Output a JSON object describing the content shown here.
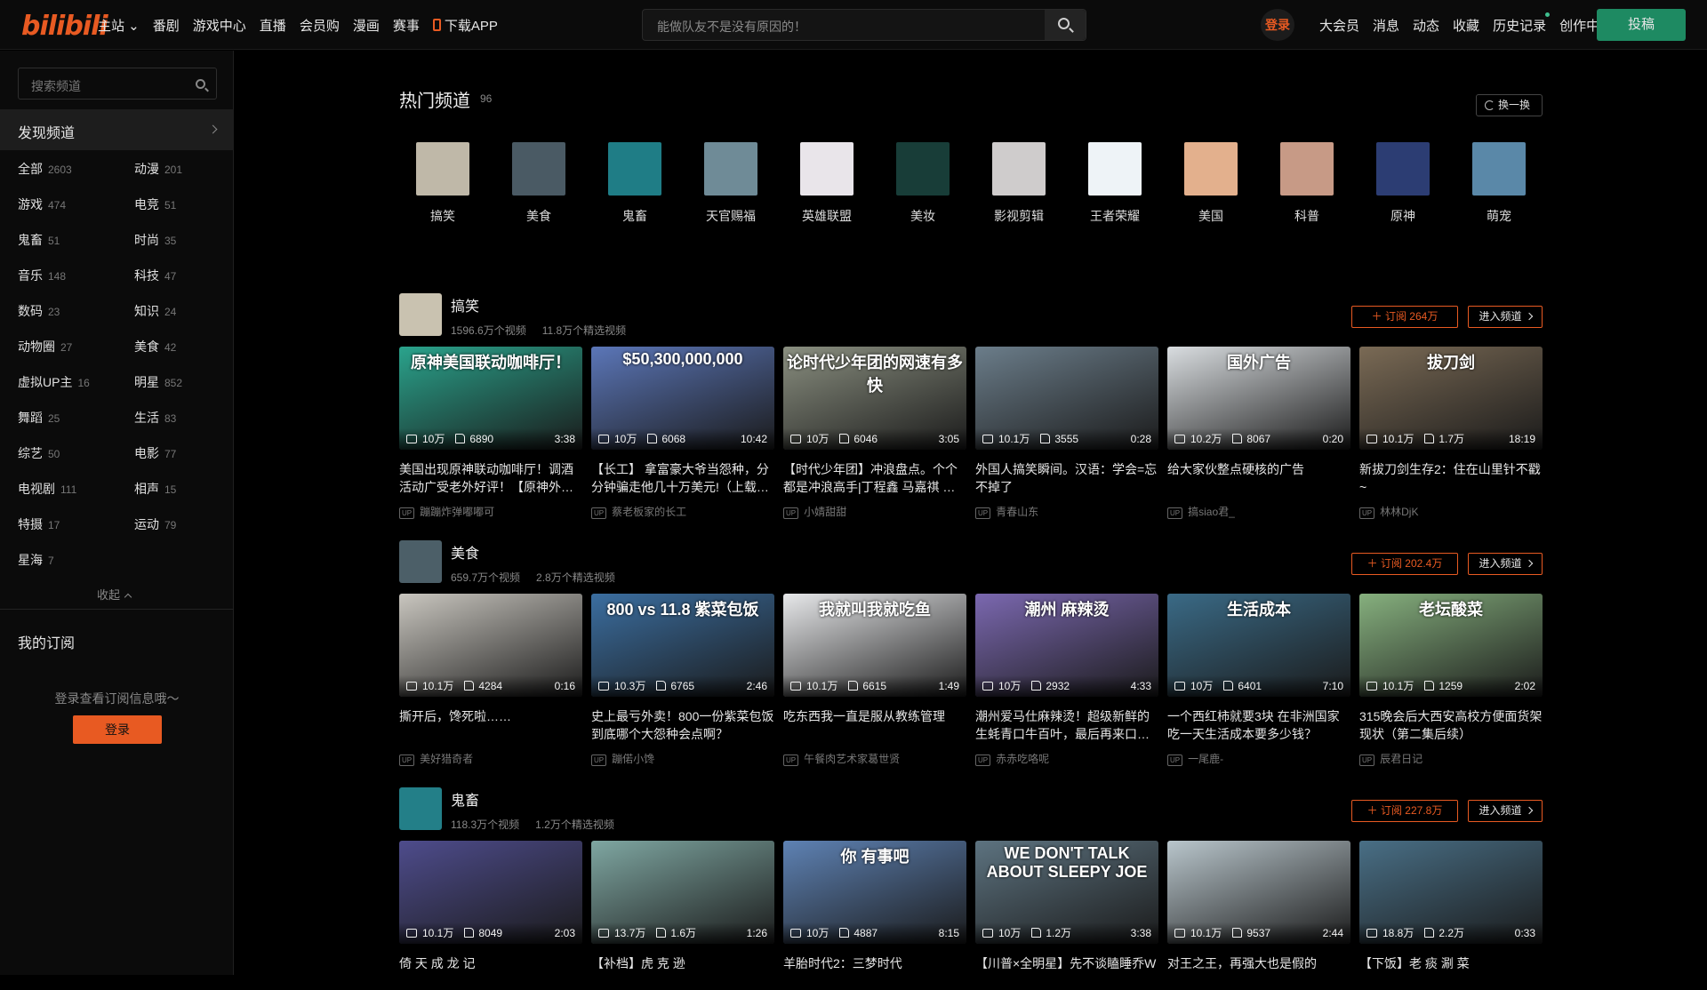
{
  "header": {
    "logo": "bilibili",
    "nav": [
      "主站",
      "番剧",
      "游戏中心",
      "直播",
      "会员购",
      "漫画",
      "赛事",
      "下载APP"
    ],
    "search_placeholder": "能做队友不是没有原因的！",
    "login": "登录",
    "right_nav": [
      "大会员",
      "消息",
      "动态",
      "收藏",
      "历史记录",
      "创作中心"
    ],
    "post": "投稿"
  },
  "sidebar": {
    "search_placeholder": "搜索频道",
    "discover": "发现频道",
    "categories": [
      {
        "name": "全部",
        "count": "2603"
      },
      {
        "name": "动漫",
        "count": "201"
      },
      {
        "name": "游戏",
        "count": "474"
      },
      {
        "name": "电竞",
        "count": "51"
      },
      {
        "name": "鬼畜",
        "count": "51"
      },
      {
        "name": "时尚",
        "count": "35"
      },
      {
        "name": "音乐",
        "count": "148"
      },
      {
        "name": "科技",
        "count": "47"
      },
      {
        "name": "数码",
        "count": "23"
      },
      {
        "name": "知识",
        "count": "24"
      },
      {
        "name": "动物圈",
        "count": "27"
      },
      {
        "name": "美食",
        "count": "42"
      },
      {
        "name": "虚拟UP主",
        "count": "16"
      },
      {
        "name": "明星",
        "count": "852"
      },
      {
        "name": "舞蹈",
        "count": "25"
      },
      {
        "name": "生活",
        "count": "83"
      },
      {
        "name": "综艺",
        "count": "50"
      },
      {
        "name": "电影",
        "count": "77"
      },
      {
        "name": "电视剧",
        "count": "111"
      },
      {
        "name": "相声",
        "count": "15"
      },
      {
        "name": "特摄",
        "count": "17"
      },
      {
        "name": "运动",
        "count": "79"
      },
      {
        "name": "星海",
        "count": "7"
      }
    ],
    "collapse": "收起",
    "my_sub": "我的订阅",
    "sub_hint": "登录查看订阅信息哦～",
    "login": "登录"
  },
  "hot": {
    "title": "热门频道",
    "count": "96",
    "refresh": "换一换",
    "channels": [
      {
        "name": "搞笑",
        "color": "#bfb8a8"
      },
      {
        "name": "美食",
        "color": "#4a5a64"
      },
      {
        "name": "鬼畜",
        "color": "#1f7d86"
      },
      {
        "name": "天官赐福",
        "color": "#6f8b97"
      },
      {
        "name": "英雄联盟",
        "color": "#e9e5ea"
      },
      {
        "name": "美妆",
        "color": "#183d38"
      },
      {
        "name": "影视剪辑",
        "color": "#cfcccc"
      },
      {
        "name": "王者荣耀",
        "color": "#eef3f7"
      },
      {
        "name": "美国",
        "color": "#e3b08d"
      },
      {
        "name": "科普",
        "color": "#c79a86"
      },
      {
        "name": "原神",
        "color": "#2c3d73"
      },
      {
        "name": "萌宠",
        "color": "#5a88a8"
      }
    ]
  },
  "sections": [
    {
      "name": "搞笑",
      "videos": "1596.6万个视频",
      "selected": "11.8万个精选视频",
      "subscribe": "＋ 订阅 264万",
      "enter": "进入频道",
      "avatar_color": "#c9c2b0",
      "cards": [
        {
          "caption": "原神美国联动咖啡厅！",
          "color": "#2aa38c",
          "plays": "10万",
          "likes": "6890",
          "duration": "3:38",
          "title": "美国出现原神联动咖啡厅！调酒活动广受老外好评！【原神外…",
          "up": "蹦蹦炸弹嘟嘟可"
        },
        {
          "caption": "$50,300,000,000",
          "color": "#5b76b8",
          "plays": "10万",
          "likes": "6068",
          "duration": "10:42",
          "title": "【长工】 拿富豪大爷当怨种，分分钟骗走他几十万美元!（上载…",
          "up": "蔡老板家的长工"
        },
        {
          "caption": "论时代少年团的网速有多快",
          "color": "#8a8f80",
          "plays": "10万",
          "likes": "6046",
          "duration": "3:05",
          "title": "【时代少年团】冲浪盘点。个个都是冲浪高手|丁程鑫 马嘉祺 …",
          "up": "小婧甜甜"
        },
        {
          "caption": "",
          "color": "#6b7d8a",
          "plays": "10.1万",
          "likes": "3555",
          "duration": "0:28",
          "title": "外国人搞笑瞬间。汉语：学会=忘不掉了",
          "up": "青春山东"
        },
        {
          "caption": "国外广告",
          "color": "#d9dde0",
          "plays": "10.2万",
          "likes": "8067",
          "duration": "0:20",
          "title": "给大家伙整点硬核的广告",
          "up": "搞siao君_"
        },
        {
          "caption": "拔刀剑",
          "color": "#7a6a55",
          "plays": "10.1万",
          "likes": "1.7万",
          "duration": "18:19",
          "title": "新拔刀剑生存2：住在山里针不戳~",
          "up": "林林DjK"
        }
      ]
    },
    {
      "name": "美食",
      "videos": "659.7万个视频",
      "selected": "2.8万个精选视频",
      "subscribe": "＋ 订阅 202.4万",
      "enter": "进入频道",
      "avatar_color": "#4c5f68",
      "cards": [
        {
          "caption": "",
          "color": "#c9c6bf",
          "plays": "10.1万",
          "likes": "4284",
          "duration": "0:16",
          "title": "撕开后，馋死啦……",
          "up": "美好猎奇者"
        },
        {
          "caption": "800 vs 11.8 紫菜包饭",
          "color": "#3b6ea0",
          "plays": "10.3万",
          "likes": "6765",
          "duration": "2:46",
          "title": "史上最亏外卖！800一份紫菜包饭到底哪个大怨种会点啊？",
          "up": "蹦偌小馋"
        },
        {
          "caption": "我就叫我就吃鱼",
          "color": "#e7e8ea",
          "plays": "10.1万",
          "likes": "6615",
          "duration": "1:49",
          "title": "吃东西我一直是服从教练管理",
          "up": "午餐肉艺术家葛世贤"
        },
        {
          "caption": "潮州 麻辣烫",
          "color": "#7b68b0",
          "plays": "10万",
          "likes": "2932",
          "duration": "4:33",
          "title": "潮州爱马仕麻辣烫！超级新鲜的生蚝青口牛百叶，最后再来口…",
          "up": "赤赤吃咯呢"
        },
        {
          "caption": "生活成本",
          "color": "#3a6a86",
          "plays": "10万",
          "likes": "6401",
          "duration": "7:10",
          "title": "一个西红柿就要3块 在非洲国家吃一天生活成本要多少钱？",
          "up": "一尾鹿-"
        },
        {
          "caption": "老坛酸菜",
          "color": "#86b07e",
          "plays": "10.1万",
          "likes": "1259",
          "duration": "2:02",
          "title": "315晚会后大西安高校方便面货架现状（第二集后续）",
          "up": "辰君日记"
        }
      ]
    },
    {
      "name": "鬼畜",
      "videos": "118.3万个视频",
      "selected": "1.2万个精选视频",
      "subscribe": "＋ 订阅 227.8万",
      "enter": "进入频道",
      "avatar_color": "#237f88",
      "cards": [
        {
          "caption": "",
          "color": "#4e4c8c",
          "plays": "10.1万",
          "likes": "8049",
          "duration": "2:03",
          "title": "倚 天 成 龙 记",
          "up": ""
        },
        {
          "caption": "",
          "color": "#7fa7a2",
          "plays": "13.7万",
          "likes": "1.6万",
          "duration": "1:26",
          "title": "【补档】虎 克 逊",
          "up": ""
        },
        {
          "caption": "你 有事吧",
          "color": "#5e82b4",
          "plays": "10万",
          "likes": "4887",
          "duration": "8:15",
          "title": "羊胎时代2：三梦时代",
          "up": ""
        },
        {
          "caption": "WE DON'T TALK ABOUT SLEEPY JOE",
          "color": "#5d7380",
          "plays": "10万",
          "likes": "1.2万",
          "duration": "3:38",
          "title": "【川普×全明星】先不谈瞌睡乔W",
          "up": ""
        },
        {
          "caption": "",
          "color": "#b9c6cc",
          "plays": "10.1万",
          "likes": "9537",
          "duration": "2:44",
          "title": "对王之王，再强大也是假的",
          "up": ""
        },
        {
          "caption": "",
          "color": "#496f86",
          "plays": "18.8万",
          "likes": "2.2万",
          "duration": "0:33",
          "title": "【下饭】老 痰 涮 菜",
          "up": ""
        }
      ]
    }
  ]
}
